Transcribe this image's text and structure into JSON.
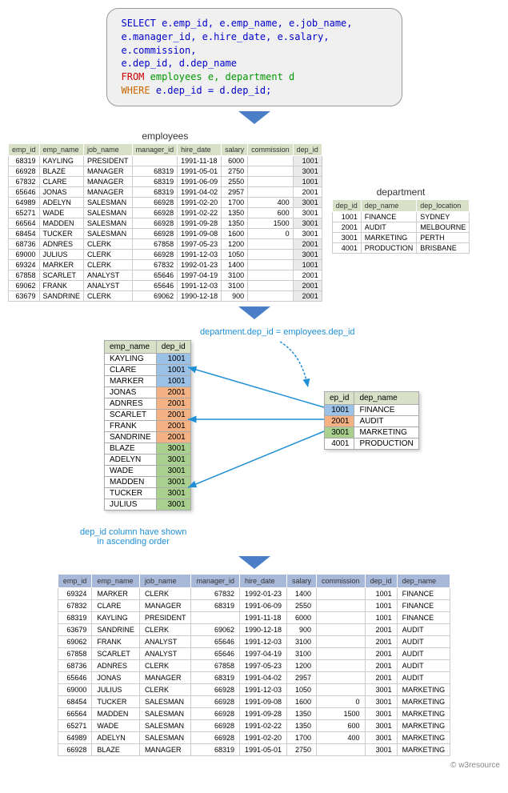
{
  "sql": {
    "select_kw": "SELECT",
    "cols": " e.emp_id,  e.emp_name, e.job_name,\n               e.manager_id, e.hire_date, e.salary, e.commission,\n               e.dep_id, d.dep_name",
    "from_kw": "FROM",
    "from_tables": " employees e, department d",
    "where_kw": "WHERE",
    "where_cond": " e.dep_id = d.dep_id;"
  },
  "labels": {
    "employees": "employees",
    "department": "department",
    "join_cond": "department.dep_id = employees.dep_id",
    "asc_note1": "dep_id column have shown",
    "asc_note2": "in ascending order",
    "credit": "© w3resource"
  },
  "emp_cols": [
    "emp_id",
    "emp_name",
    "job_name",
    "manager_id",
    "hire_date",
    "salary",
    "commission",
    "dep_id"
  ],
  "employees": [
    {
      "emp_id": 68319,
      "emp_name": "KAYLING",
      "job_name": "PRESIDENT",
      "manager_id": "",
      "hire_date": "1991-11-18",
      "salary": 6000,
      "commission": "",
      "dep_id": 1001,
      "shade": 1
    },
    {
      "emp_id": 66928,
      "emp_name": "BLAZE",
      "job_name": "MANAGER",
      "manager_id": 68319,
      "hire_date": "1991-05-01",
      "salary": 2750,
      "commission": "",
      "dep_id": 3001,
      "shade": 1
    },
    {
      "emp_id": 67832,
      "emp_name": "CLARE",
      "job_name": "MANAGER",
      "manager_id": 68319,
      "hire_date": "1991-06-09",
      "salary": 2550,
      "commission": "",
      "dep_id": 1001,
      "shade": 1
    },
    {
      "emp_id": 65646,
      "emp_name": "JONAS",
      "job_name": "MANAGER",
      "manager_id": 68319,
      "hire_date": "1991-04-02",
      "salary": 2957,
      "commission": "",
      "dep_id": 2001,
      "shade": 0
    },
    {
      "emp_id": 64989,
      "emp_name": "ADELYN",
      "job_name": "SALESMAN",
      "manager_id": 66928,
      "hire_date": "1991-02-20",
      "salary": 1700,
      "commission": 400,
      "dep_id": 3001,
      "shade": 1
    },
    {
      "emp_id": 65271,
      "emp_name": "WADE",
      "job_name": "SALESMAN",
      "manager_id": 66928,
      "hire_date": "1991-02-22",
      "salary": 1350,
      "commission": 600,
      "dep_id": 3001,
      "shade": 0
    },
    {
      "emp_id": 66564,
      "emp_name": "MADDEN",
      "job_name": "SALESMAN",
      "manager_id": 66928,
      "hire_date": "1991-09-28",
      "salary": 1350,
      "commission": 1500,
      "dep_id": 3001,
      "shade": 1
    },
    {
      "emp_id": 68454,
      "emp_name": "TUCKER",
      "job_name": "SALESMAN",
      "manager_id": 66928,
      "hire_date": "1991-09-08",
      "salary": 1600,
      "commission": 0,
      "dep_id": 3001,
      "shade": 0
    },
    {
      "emp_id": 68736,
      "emp_name": "ADNRES",
      "job_name": "CLERK",
      "manager_id": 67858,
      "hire_date": "1997-05-23",
      "salary": 1200,
      "commission": "",
      "dep_id": 2001,
      "shade": 1
    },
    {
      "emp_id": 69000,
      "emp_name": "JULIUS",
      "job_name": "CLERK",
      "manager_id": 66928,
      "hire_date": "1991-12-03",
      "salary": 1050,
      "commission": "",
      "dep_id": 3001,
      "shade": 1
    },
    {
      "emp_id": 69324,
      "emp_name": "MARKER",
      "job_name": "CLERK",
      "manager_id": 67832,
      "hire_date": "1992-01-23",
      "salary": 1400,
      "commission": "",
      "dep_id": 1001,
      "shade": 1
    },
    {
      "emp_id": 67858,
      "emp_name": "SCARLET",
      "job_name": "ANALYST",
      "manager_id": 65646,
      "hire_date": "1997-04-19",
      "salary": 3100,
      "commission": "",
      "dep_id": 2001,
      "shade": 0
    },
    {
      "emp_id": 69062,
      "emp_name": "FRANK",
      "job_name": "ANALYST",
      "manager_id": 65646,
      "hire_date": "1991-12-03",
      "salary": 3100,
      "commission": "",
      "dep_id": 2001,
      "shade": 1
    },
    {
      "emp_id": 63679,
      "emp_name": "SANDRINE",
      "job_name": "CLERK",
      "manager_id": 69062,
      "hire_date": "1990-12-18",
      "salary": 900,
      "commission": "",
      "dep_id": 2001,
      "shade": 1
    }
  ],
  "dep_cols": [
    "dep_id",
    "dep_name",
    "dep_location"
  ],
  "departments": [
    {
      "dep_id": 1001,
      "dep_name": "FINANCE",
      "dep_location": "SYDNEY"
    },
    {
      "dep_id": 2001,
      "dep_name": "AUDIT",
      "dep_location": "MELBOURNE"
    },
    {
      "dep_id": 3001,
      "dep_name": "MARKETING",
      "dep_location": "PERTH"
    },
    {
      "dep_id": 4001,
      "dep_name": "PRODUCTION",
      "dep_location": "BRISBANE"
    }
  ],
  "mini_left_cols": [
    "emp_name",
    "dep_id"
  ],
  "mini_left": [
    {
      "emp_name": "KAYLING",
      "dep_id": 1001,
      "cls": "c-blue"
    },
    {
      "emp_name": "CLARE",
      "dep_id": 1001,
      "cls": "c-blue"
    },
    {
      "emp_name": "MARKER",
      "dep_id": 1001,
      "cls": "c-blue"
    },
    {
      "emp_name": "JONAS",
      "dep_id": 2001,
      "cls": "c-orange"
    },
    {
      "emp_name": "ADNRES",
      "dep_id": 2001,
      "cls": "c-orange"
    },
    {
      "emp_name": "SCARLET",
      "dep_id": 2001,
      "cls": "c-orange"
    },
    {
      "emp_name": "FRANK",
      "dep_id": 2001,
      "cls": "c-orange"
    },
    {
      "emp_name": "SANDRINE",
      "dep_id": 2001,
      "cls": "c-orange"
    },
    {
      "emp_name": "BLAZE",
      "dep_id": 3001,
      "cls": "c-green"
    },
    {
      "emp_name": "ADELYN",
      "dep_id": 3001,
      "cls": "c-green"
    },
    {
      "emp_name": "WADE",
      "dep_id": 3001,
      "cls": "c-green"
    },
    {
      "emp_name": "MADDEN",
      "dep_id": 3001,
      "cls": "c-green"
    },
    {
      "emp_name": "TUCKER",
      "dep_id": 3001,
      "cls": "c-green"
    },
    {
      "emp_name": "JULIUS",
      "dep_id": 3001,
      "cls": "c-green"
    }
  ],
  "mini_right_cols": [
    "ep_id",
    "dep_name"
  ],
  "mini_right": [
    {
      "dep_id": 1001,
      "dep_name": "FINANCE",
      "cls": "c-blue"
    },
    {
      "dep_id": 2001,
      "dep_name": "AUDIT",
      "cls": "c-orange"
    },
    {
      "dep_id": 3001,
      "dep_name": "MARKETING",
      "cls": "c-green"
    },
    {
      "dep_id": 4001,
      "dep_name": "PRODUCTION",
      "cls": ""
    }
  ],
  "result_cols": [
    "emp_id",
    "emp_name",
    "job_name",
    "manager_id",
    "hire_date",
    "salary",
    "commission",
    "dep_id",
    "dep_name"
  ],
  "result": [
    {
      "emp_id": 69324,
      "emp_name": "MARKER",
      "job_name": "CLERK",
      "manager_id": 67832,
      "hire_date": "1992-01-23",
      "salary": 1400,
      "commission": "",
      "dep_id": 1001,
      "dep_name": "FINANCE"
    },
    {
      "emp_id": 67832,
      "emp_name": "CLARE",
      "job_name": "MANAGER",
      "manager_id": 68319,
      "hire_date": "1991-06-09",
      "salary": 2550,
      "commission": "",
      "dep_id": 1001,
      "dep_name": "FINANCE"
    },
    {
      "emp_id": 68319,
      "emp_name": "KAYLING",
      "job_name": "PRESIDENT",
      "manager_id": "",
      "hire_date": "1991-11-18",
      "salary": 6000,
      "commission": "",
      "dep_id": 1001,
      "dep_name": "FINANCE"
    },
    {
      "emp_id": 63679,
      "emp_name": "SANDRINE",
      "job_name": "CLERK",
      "manager_id": 69062,
      "hire_date": "1990-12-18",
      "salary": 900,
      "commission": "",
      "dep_id": 2001,
      "dep_name": "AUDIT"
    },
    {
      "emp_id": 69062,
      "emp_name": "FRANK",
      "job_name": "ANALYST",
      "manager_id": 65646,
      "hire_date": "1991-12-03",
      "salary": 3100,
      "commission": "",
      "dep_id": 2001,
      "dep_name": "AUDIT"
    },
    {
      "emp_id": 67858,
      "emp_name": "SCARLET",
      "job_name": "ANALYST",
      "manager_id": 65646,
      "hire_date": "1997-04-19",
      "salary": 3100,
      "commission": "",
      "dep_id": 2001,
      "dep_name": "AUDIT"
    },
    {
      "emp_id": 68736,
      "emp_name": "ADNRES",
      "job_name": "CLERK",
      "manager_id": 67858,
      "hire_date": "1997-05-23",
      "salary": 1200,
      "commission": "",
      "dep_id": 2001,
      "dep_name": "AUDIT"
    },
    {
      "emp_id": 65646,
      "emp_name": "JONAS",
      "job_name": "MANAGER",
      "manager_id": 68319,
      "hire_date": "1991-04-02",
      "salary": 2957,
      "commission": "",
      "dep_id": 2001,
      "dep_name": "AUDIT"
    },
    {
      "emp_id": 69000,
      "emp_name": "JULIUS",
      "job_name": "CLERK",
      "manager_id": 66928,
      "hire_date": "1991-12-03",
      "salary": 1050,
      "commission": "",
      "dep_id": 3001,
      "dep_name": "MARKETING"
    },
    {
      "emp_id": 68454,
      "emp_name": "TUCKER",
      "job_name": "SALESMAN",
      "manager_id": 66928,
      "hire_date": "1991-09-08",
      "salary": 1600,
      "commission": 0,
      "dep_id": 3001,
      "dep_name": "MARKETING"
    },
    {
      "emp_id": 66564,
      "emp_name": "MADDEN",
      "job_name": "SALESMAN",
      "manager_id": 66928,
      "hire_date": "1991-09-28",
      "salary": 1350,
      "commission": 1500,
      "dep_id": 3001,
      "dep_name": "MARKETING"
    },
    {
      "emp_id": 65271,
      "emp_name": "WADE",
      "job_name": "SALESMAN",
      "manager_id": 66928,
      "hire_date": "1991-02-22",
      "salary": 1350,
      "commission": 600,
      "dep_id": 3001,
      "dep_name": "MARKETING"
    },
    {
      "emp_id": 64989,
      "emp_name": "ADELYN",
      "job_name": "SALESMAN",
      "manager_id": 66928,
      "hire_date": "1991-02-20",
      "salary": 1700,
      "commission": 400,
      "dep_id": 3001,
      "dep_name": "MARKETING"
    },
    {
      "emp_id": 66928,
      "emp_name": "BLAZE",
      "job_name": "MANAGER",
      "manager_id": 68319,
      "hire_date": "1991-05-01",
      "salary": 2750,
      "commission": "",
      "dep_id": 3001,
      "dep_name": "MARKETING"
    }
  ]
}
